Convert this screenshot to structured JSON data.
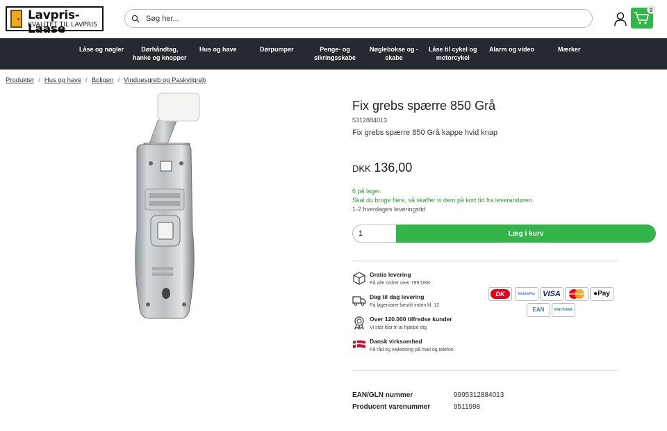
{
  "header": {
    "logo_name": "Lavpris-Laase",
    "logo_tagline": "KVALITET TIL LAVPRIS",
    "search_placeholder": "Søg her...",
    "cart_count": "0"
  },
  "nav": {
    "items": [
      {
        "line1": "Låse og nøgler",
        "line2": ""
      },
      {
        "line1": "Dørhåndtag,",
        "line2": "hanke og knopper"
      },
      {
        "line1": "Hus og have",
        "line2": ""
      },
      {
        "line1": "Dørpumper",
        "line2": ""
      },
      {
        "line1": "Penge- og",
        "line2": "sikringsskabe"
      },
      {
        "line1": "Nøglebokse og -",
        "line2": "skabe"
      },
      {
        "line1": "Låse til cykel og",
        "line2": "motorcykel"
      },
      {
        "line1": "Alarm og video",
        "line2": ""
      },
      {
        "line1": "Mærker",
        "line2": ""
      }
    ]
  },
  "breadcrumb": [
    "Produkter",
    "Hus og have",
    "Boligen",
    "Vinduesgreb og Paskvilgreb"
  ],
  "product": {
    "title": "Fix grebs spærre 850 Grå",
    "sku": "5312884013",
    "subtitle": "Fix grebs spærre 850 Grå kappe hvid knap",
    "currency": "DKK",
    "price": "136,00",
    "stock_line1": "6 på lager.",
    "stock_line2": "Skal du bruge flere, så skaffer vi dem på kort tid fra leverandøren.",
    "delivery_time": "1-2 hverdages leveringstid",
    "quantity": "1",
    "add_to_cart": "Læg i kurv"
  },
  "features": [
    {
      "title": "Gratis levering",
      "sub": "På alle ordrer over 799 DKK",
      "icon": "box-icon"
    },
    {
      "title": "Dag til dag levering",
      "sub": "På lagervarer bestilt inden kl. 12",
      "icon": "truck-icon"
    },
    {
      "title": "Over 120.000 tilfredse kunder",
      "sub": "Vi står klar til at hjælpe dig",
      "icon": "award-icon"
    },
    {
      "title": "Dansk virksomhed",
      "sub": "Få råd og vejledning på mail og telefon",
      "icon": "danish-flag-icon"
    }
  ],
  "payments": {
    "dankort": "DK",
    "mobilepay": "MobilePay",
    "visa": "VISA",
    "mastercard": "MasterCard",
    "applepay": "Pay",
    "ean": "EAN",
    "faktura": "FAKTURA"
  },
  "specs": [
    {
      "label": "EAN/GLN nummer",
      "value": "9995312884013"
    },
    {
      "label": "Producent varenummer",
      "value": "9511998"
    }
  ],
  "colors": {
    "accent_green": "#33b54a",
    "nav_bg": "#252a31",
    "stock_green": "#2e9a3e"
  }
}
